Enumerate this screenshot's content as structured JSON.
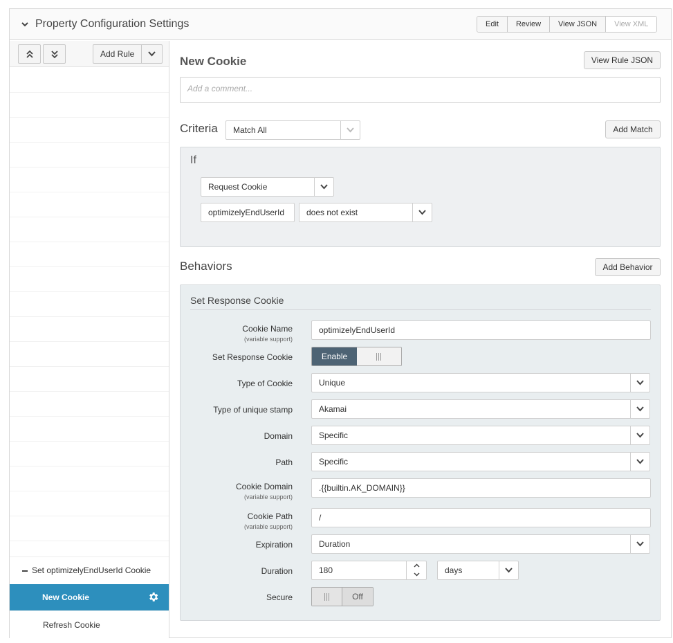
{
  "header": {
    "title": "Property Configuration Settings",
    "buttons": [
      "Edit",
      "Review",
      "View JSON",
      "View XML"
    ]
  },
  "sidebar": {
    "add_rule_label": "Add Rule",
    "parent_rule": "Set optimizelyEndUserId Cookie",
    "active_rule": "New Cookie",
    "other_rule": "Refresh Cookie"
  },
  "rule": {
    "title": "New Cookie",
    "view_json_label": "View Rule JSON",
    "comment_placeholder": "Add a comment..."
  },
  "criteria": {
    "title": "Criteria",
    "match_mode": "Match All",
    "add_match_label": "Add Match",
    "if_label": "If",
    "condition_type": "Request Cookie",
    "cookie_name": "optimizelyEndUserId",
    "operator": "does not exist"
  },
  "behaviors": {
    "title": "Behaviors",
    "add_behavior_label": "Add Behavior",
    "behavior_name": "Set Response Cookie",
    "variable_support": "(variable support)",
    "fields": {
      "cookie_name_label": "Cookie Name",
      "cookie_name_value": "optimizelyEndUserId",
      "set_response_label": "Set Response Cookie",
      "set_response_toggle": "Enable",
      "type_label": "Type of Cookie",
      "type_value": "Unique",
      "stamp_label": "Type of unique stamp",
      "stamp_value": "Akamai",
      "domain_label": "Domain",
      "domain_value": "Specific",
      "path_label": "Path",
      "path_value": "Specific",
      "cookie_domain_label": "Cookie Domain",
      "cookie_domain_value": ".{{builtin.AK_DOMAIN}}",
      "cookie_path_label": "Cookie Path",
      "cookie_path_value": "/",
      "expiration_label": "Expiration",
      "expiration_value": "Duration",
      "duration_label": "Duration",
      "duration_value": "180",
      "duration_unit": "days",
      "secure_label": "Secure",
      "secure_toggle": "Off"
    }
  }
}
